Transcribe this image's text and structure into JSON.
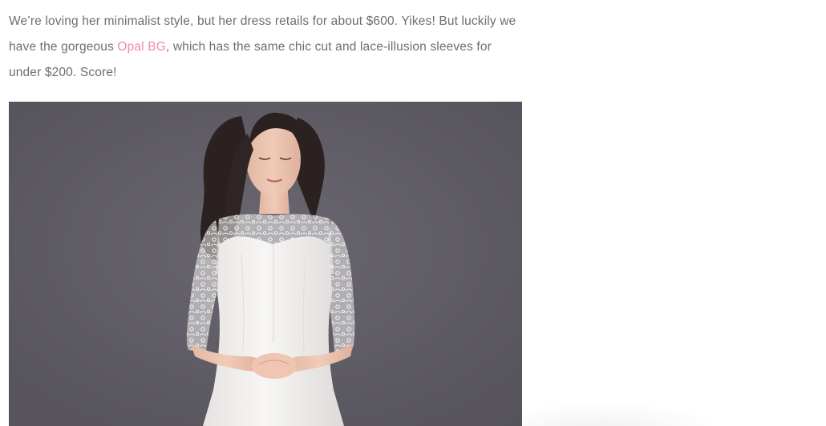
{
  "article": {
    "text_before_link": "We’re loving her minimalist style, but her dress retails for about $600. Yikes! But luckily we have the gorgeous ",
    "link_text": "Opal BG",
    "text_after_link": ", which has the same chic cut and lace-illusion sleeves for under $200. Score!"
  },
  "colors": {
    "link": "#f08aa6",
    "body_text": "#6e6e6e",
    "photo_background": "#615e68"
  },
  "photo": {
    "subject": "woman-in-white-lace-sleeve-dress"
  }
}
